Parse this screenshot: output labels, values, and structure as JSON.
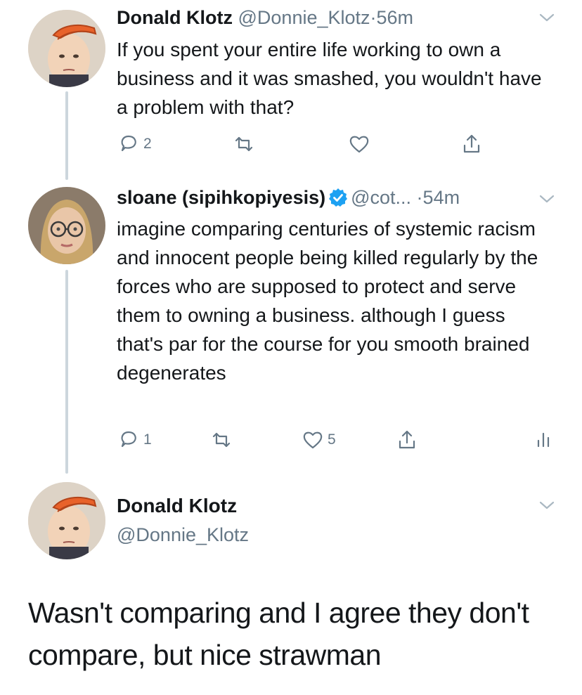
{
  "tweets": [
    {
      "name": "Donald Klotz",
      "handle": "@Donnie_Klotz",
      "separator": "·",
      "time": "56m",
      "avatar_icon": "orange-hair-portrait",
      "text": "If you spent your entire life working to own a business and it was smashed, you wouldn't have a problem with that?",
      "replies": "2",
      "retweets": "",
      "likes": ""
    },
    {
      "name": "sloane (sipihkopiyesis)",
      "verified": true,
      "handle": "@cot...",
      "separator": "·",
      "time": "54m",
      "avatar_icon": "woman-with-glasses-portrait",
      "text": "imagine comparing centuries of systemic racism and innocent people being killed regularly by the forces who are supposed to protect and serve them to owning a business. although I guess that's par for the course for you smooth brained degenerates",
      "replies": "1",
      "retweets": "",
      "likes": "5"
    }
  ],
  "main_tweet": {
    "name": "Donald Klotz",
    "handle": "@Donnie_Klotz",
    "avatar_icon": "orange-hair-portrait",
    "text": "Wasn't comparing and I agree they don't compare, but nice strawman"
  },
  "colors": {
    "text": "#14171a",
    "secondary": "#657786",
    "verified": "#1da1f2",
    "thread_line": "#ccd6dd",
    "hair": "#e8622a"
  }
}
